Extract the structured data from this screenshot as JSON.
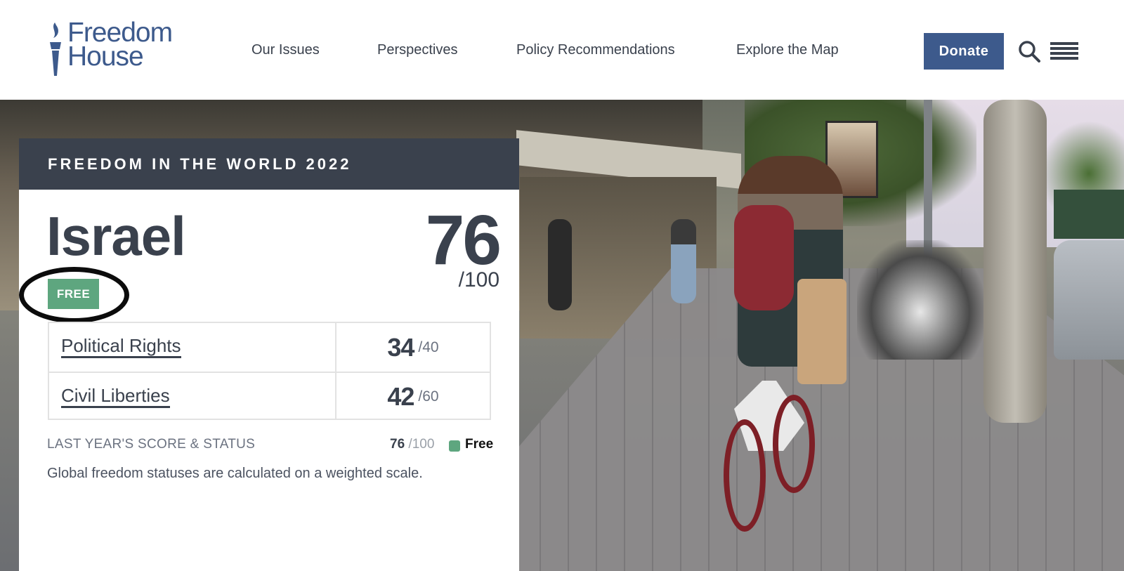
{
  "header": {
    "logo_line1": "Freedom",
    "logo_line2": "House",
    "nav": [
      {
        "label": "Our Issues"
      },
      {
        "label": "Perspectives"
      },
      {
        "label": "Policy Recommendations"
      },
      {
        "label": "Explore the Map"
      }
    ],
    "donate_label": "Donate",
    "search_icon": "search-icon",
    "menu_icon": "hamburger-menu-icon"
  },
  "card": {
    "banner": "FREEDOM IN THE WORLD 2022",
    "country": "Israel",
    "status": "FREE",
    "total_score": "76",
    "total_max": "/100",
    "rows": [
      {
        "label": "Political Rights",
        "score": "34",
        "max": "/40"
      },
      {
        "label": "Civil Liberties",
        "score": "42",
        "max": "/60"
      }
    ],
    "last_year_label": "LAST YEAR'S SCORE & STATUS",
    "last_year_score": "76",
    "last_year_max": "/100",
    "last_year_status": "Free",
    "footnote": "Global freedom statuses are calculated on a weighted scale."
  },
  "colors": {
    "brand_blue": "#3d5a8c",
    "dark_slate": "#3a414d",
    "free_green": "#5ea67f"
  }
}
